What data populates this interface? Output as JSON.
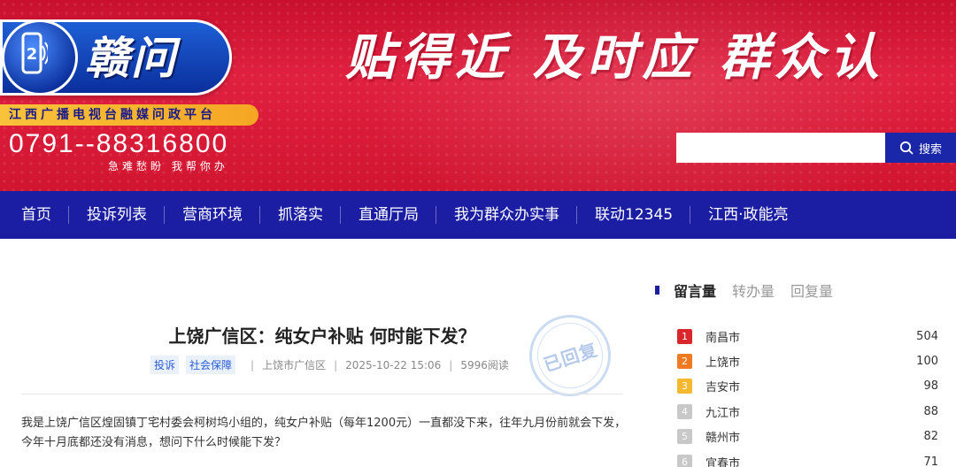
{
  "header": {
    "logo_number": "2",
    "logo_text": "赣问",
    "platform": "江西广播电视台融媒问政平台",
    "hotline": "0791--88316800",
    "hotline_sub": "急难愁盼  我帮你办",
    "slogan": "贴得近 及时应 群众认"
  },
  "search": {
    "value": "",
    "placeholder": "",
    "button_label": "搜索"
  },
  "nav": {
    "items": [
      "首页",
      "投诉列表",
      "营商环境",
      "抓落实",
      "直通厅局",
      "我为群众办实事",
      "联动12345",
      "江西·政能亮"
    ]
  },
  "article": {
    "title": "上饶广信区：纯女户补贴 何时能下发？",
    "tags": [
      "投诉",
      "社会保障"
    ],
    "location": "上饶市广信区",
    "datetime": "2025-10-22 15:06",
    "reads": "5996阅读",
    "stamp": "已回复",
    "body": "我是上饶广信区煌固镇丁宅村委会柯树坞小组的，纯女户补贴（每年1200元）一直都没下来，往年九月份前就会下发，今年十月底都还没有消息，想问下什么时候能下发？"
  },
  "sidebar": {
    "tabs": [
      "留言量",
      "转办量",
      "回复量"
    ],
    "active_tab": "留言量",
    "ranking": [
      {
        "rank": "1",
        "city": "南昌市",
        "count": "504",
        "color": "#d9262c"
      },
      {
        "rank": "2",
        "city": "上饶市",
        "count": "100",
        "color": "#f07a22"
      },
      {
        "rank": "3",
        "city": "吉安市",
        "count": "98",
        "color": "#f5b82e"
      },
      {
        "rank": "4",
        "city": "九江市",
        "count": "88",
        "color": "#c8c8c8"
      },
      {
        "rank": "5",
        "city": "赣州市",
        "count": "82",
        "color": "#c8c8c8"
      },
      {
        "rank": "6",
        "city": "宜春市",
        "count": "71",
        "color": "#c8c8c8"
      }
    ]
  },
  "colors": {
    "banner_red": "#d11530",
    "nav_blue": "#1b1ea3",
    "tag_blue": "#2a5bd7"
  }
}
